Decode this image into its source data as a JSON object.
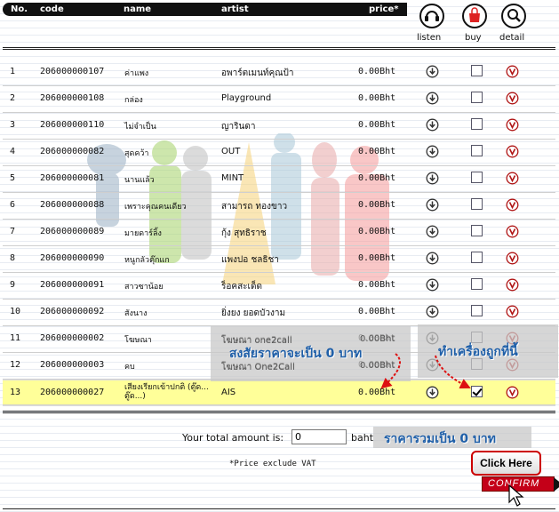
{
  "header": {
    "columns": {
      "no": "No.",
      "code": "code",
      "name": "name",
      "artist": "artist",
      "price": "price*"
    },
    "actions": {
      "listen": "listen",
      "buy": "buy",
      "detail": "detail"
    }
  },
  "rows": [
    {
      "no": "1",
      "code": "206000000107",
      "name": "ค่าแพง",
      "artist": "อพาร์ตเมนท์คุณป้า",
      "price": "0.00Bht",
      "checked": false
    },
    {
      "no": "2",
      "code": "206000000108",
      "name": "กล่อง",
      "artist": "Playground",
      "price": "0.00Bht",
      "checked": false
    },
    {
      "no": "3",
      "code": "206000000110",
      "name": "ไม่จำเป็น",
      "artist": "ญารินดา",
      "price": "0.00Bht",
      "checked": false
    },
    {
      "no": "4",
      "code": "206000000082",
      "name": "สุดคว้า",
      "artist": "OUT",
      "price": "0.00Bht",
      "checked": false
    },
    {
      "no": "5",
      "code": "206000000081",
      "name": "นานแล้ว",
      "artist": "MINT",
      "price": "0.00Bht",
      "checked": false
    },
    {
      "no": "6",
      "code": "206000000088",
      "name": "เพราะคุณคนเดียว",
      "artist": "สามารถ ทองขาว",
      "price": "0.00Bht",
      "checked": false
    },
    {
      "no": "7",
      "code": "206000000089",
      "name": "มายดาร์ลิ้ง",
      "artist": "กุ้ง สุทธิราช",
      "price": "0.00Bht",
      "checked": false
    },
    {
      "no": "8",
      "code": "206000000090",
      "name": "หนูกลัวตุ๊กแก",
      "artist": "แพงปอ ชลธิชา",
      "price": "0.00Bht",
      "checked": false
    },
    {
      "no": "9",
      "code": "206000000091",
      "name": "สาวซาน้อย",
      "artist": "ร็อคสะเด็ด",
      "price": "0.00Bht",
      "checked": false
    },
    {
      "no": "10",
      "code": "206000000092",
      "name": "สังนาง",
      "artist": "ยิ่งยง ยอดบัวงาม",
      "price": "0.00Bht",
      "checked": false
    },
    {
      "no": "11",
      "code": "206000000002",
      "name": "โฆษณา",
      "artist": "โฆษณา one2call",
      "price": "0.00Bht",
      "checked": false
    },
    {
      "no": "12",
      "code": "206000000003",
      "name": "คบ",
      "artist": "โฆษณา One2Call",
      "price": "0.00Bht",
      "checked": false
    },
    {
      "no": "13",
      "code": "206000000027",
      "name": "เสียงเรียกเข้าปกติ (ตู๊ด... ตู๊ด...)",
      "artist": "AIS",
      "price": "0.00Bht",
      "checked": true
    }
  ],
  "annotations": {
    "price_doubt": "สงสัยราคาจะเป็น 0 บาท",
    "check_here": "ทำเครื่องถูกที่นี้",
    "total_zero": "ราคารวมเป็น 0 บาท"
  },
  "total": {
    "label": "Your total amount is:",
    "value": "0",
    "unit": "baht"
  },
  "vat_note": "*Price exclude VAT",
  "click_here": "Click Here",
  "confirm": "CONFIRM",
  "colors": {
    "highlight": "#ffff99",
    "annotation": "#1f5fa8",
    "confirm": "#c40018"
  }
}
